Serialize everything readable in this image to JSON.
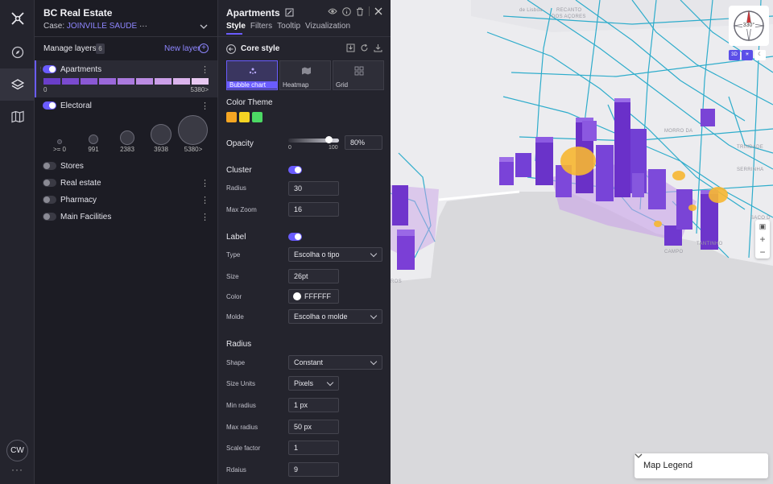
{
  "app": {
    "title": "BC Real Estate",
    "case_label": "Case:",
    "case_value": "JOINVILLE SAUDE",
    "case_more": "···"
  },
  "rail": {
    "icons": [
      "app-logo-icon",
      "compass-icon",
      "layers-icon",
      "map-icon"
    ],
    "avatar": "CW",
    "more": "···"
  },
  "layers": {
    "heading": "Manage layers",
    "count": "6",
    "new_layer": "New layer",
    "apartments": {
      "name": "Apartments",
      "min": "0",
      "max": "5380>"
    },
    "electoral": {
      "name": "Electoral",
      "bubbles": [
        ">= 0",
        "991",
        "2383",
        "3938",
        "5380>"
      ]
    },
    "others": [
      "Stores",
      "Real estate",
      "Pharmacy",
      "Main Facilities"
    ],
    "gradient_colors": [
      "#6a3ec9",
      "#7a4acf",
      "#8a58d4",
      "#9a68da",
      "#aa7ade",
      "#bb8ce3",
      "#cb9fe8",
      "#dab3ec",
      "#e7c8f1"
    ]
  },
  "editor": {
    "title": "Apartments",
    "tabs": [
      "Style",
      "Filters",
      "Tooltip",
      "Vizualization"
    ],
    "core_style": "Core style",
    "viz_types": [
      "Bubble chart",
      "Heatmap",
      "Grid"
    ],
    "color_theme_label": "Color Theme",
    "theme_colors": [
      "#f5a623",
      "#f5d423",
      "#4cd964"
    ],
    "opacity_label": "Opacity",
    "opacity_value": "80%",
    "opacity_level": 0.8,
    "slider_min": "0",
    "slider_max": "100",
    "cluster_label": "Cluster",
    "radius_label": "Radius",
    "radius_value": "30",
    "maxzoom_label": "Max Zoom",
    "maxzoom_value": "16",
    "label_label": "Label",
    "type_label": "Type",
    "type_value": "Escolha o tipo",
    "size_label": "Size",
    "size_value": "26pt",
    "color_label": "Color",
    "color_value": "FFFFFF",
    "molde_label": "Molde",
    "molde_value": "Escolha o molde",
    "radius_section": "Radius",
    "shape_label": "Shape",
    "shape_value": "Constant",
    "units_label": "Size Units",
    "units_value": "Pixels",
    "minradius_label": "Min radius",
    "minradius_value": "1 px",
    "maxradius_label": "Max radius",
    "maxradius_value": "50 px",
    "scale_label": "Scale factor",
    "scale_value": "1",
    "rdaius_label": "Rdaius",
    "rdaius_value": "9"
  },
  "map": {
    "compass_label": "330°",
    "mode_3d": "3D",
    "legend_title": "Map Legend",
    "labels": [
      "de Lisboa",
      "RECANTO",
      "DOS AÇORES",
      "MORRO DA",
      "TRINDADE",
      "SERRINHA",
      "SACO D",
      "TANTINHO",
      "CAMPO",
      "ROS"
    ]
  }
}
